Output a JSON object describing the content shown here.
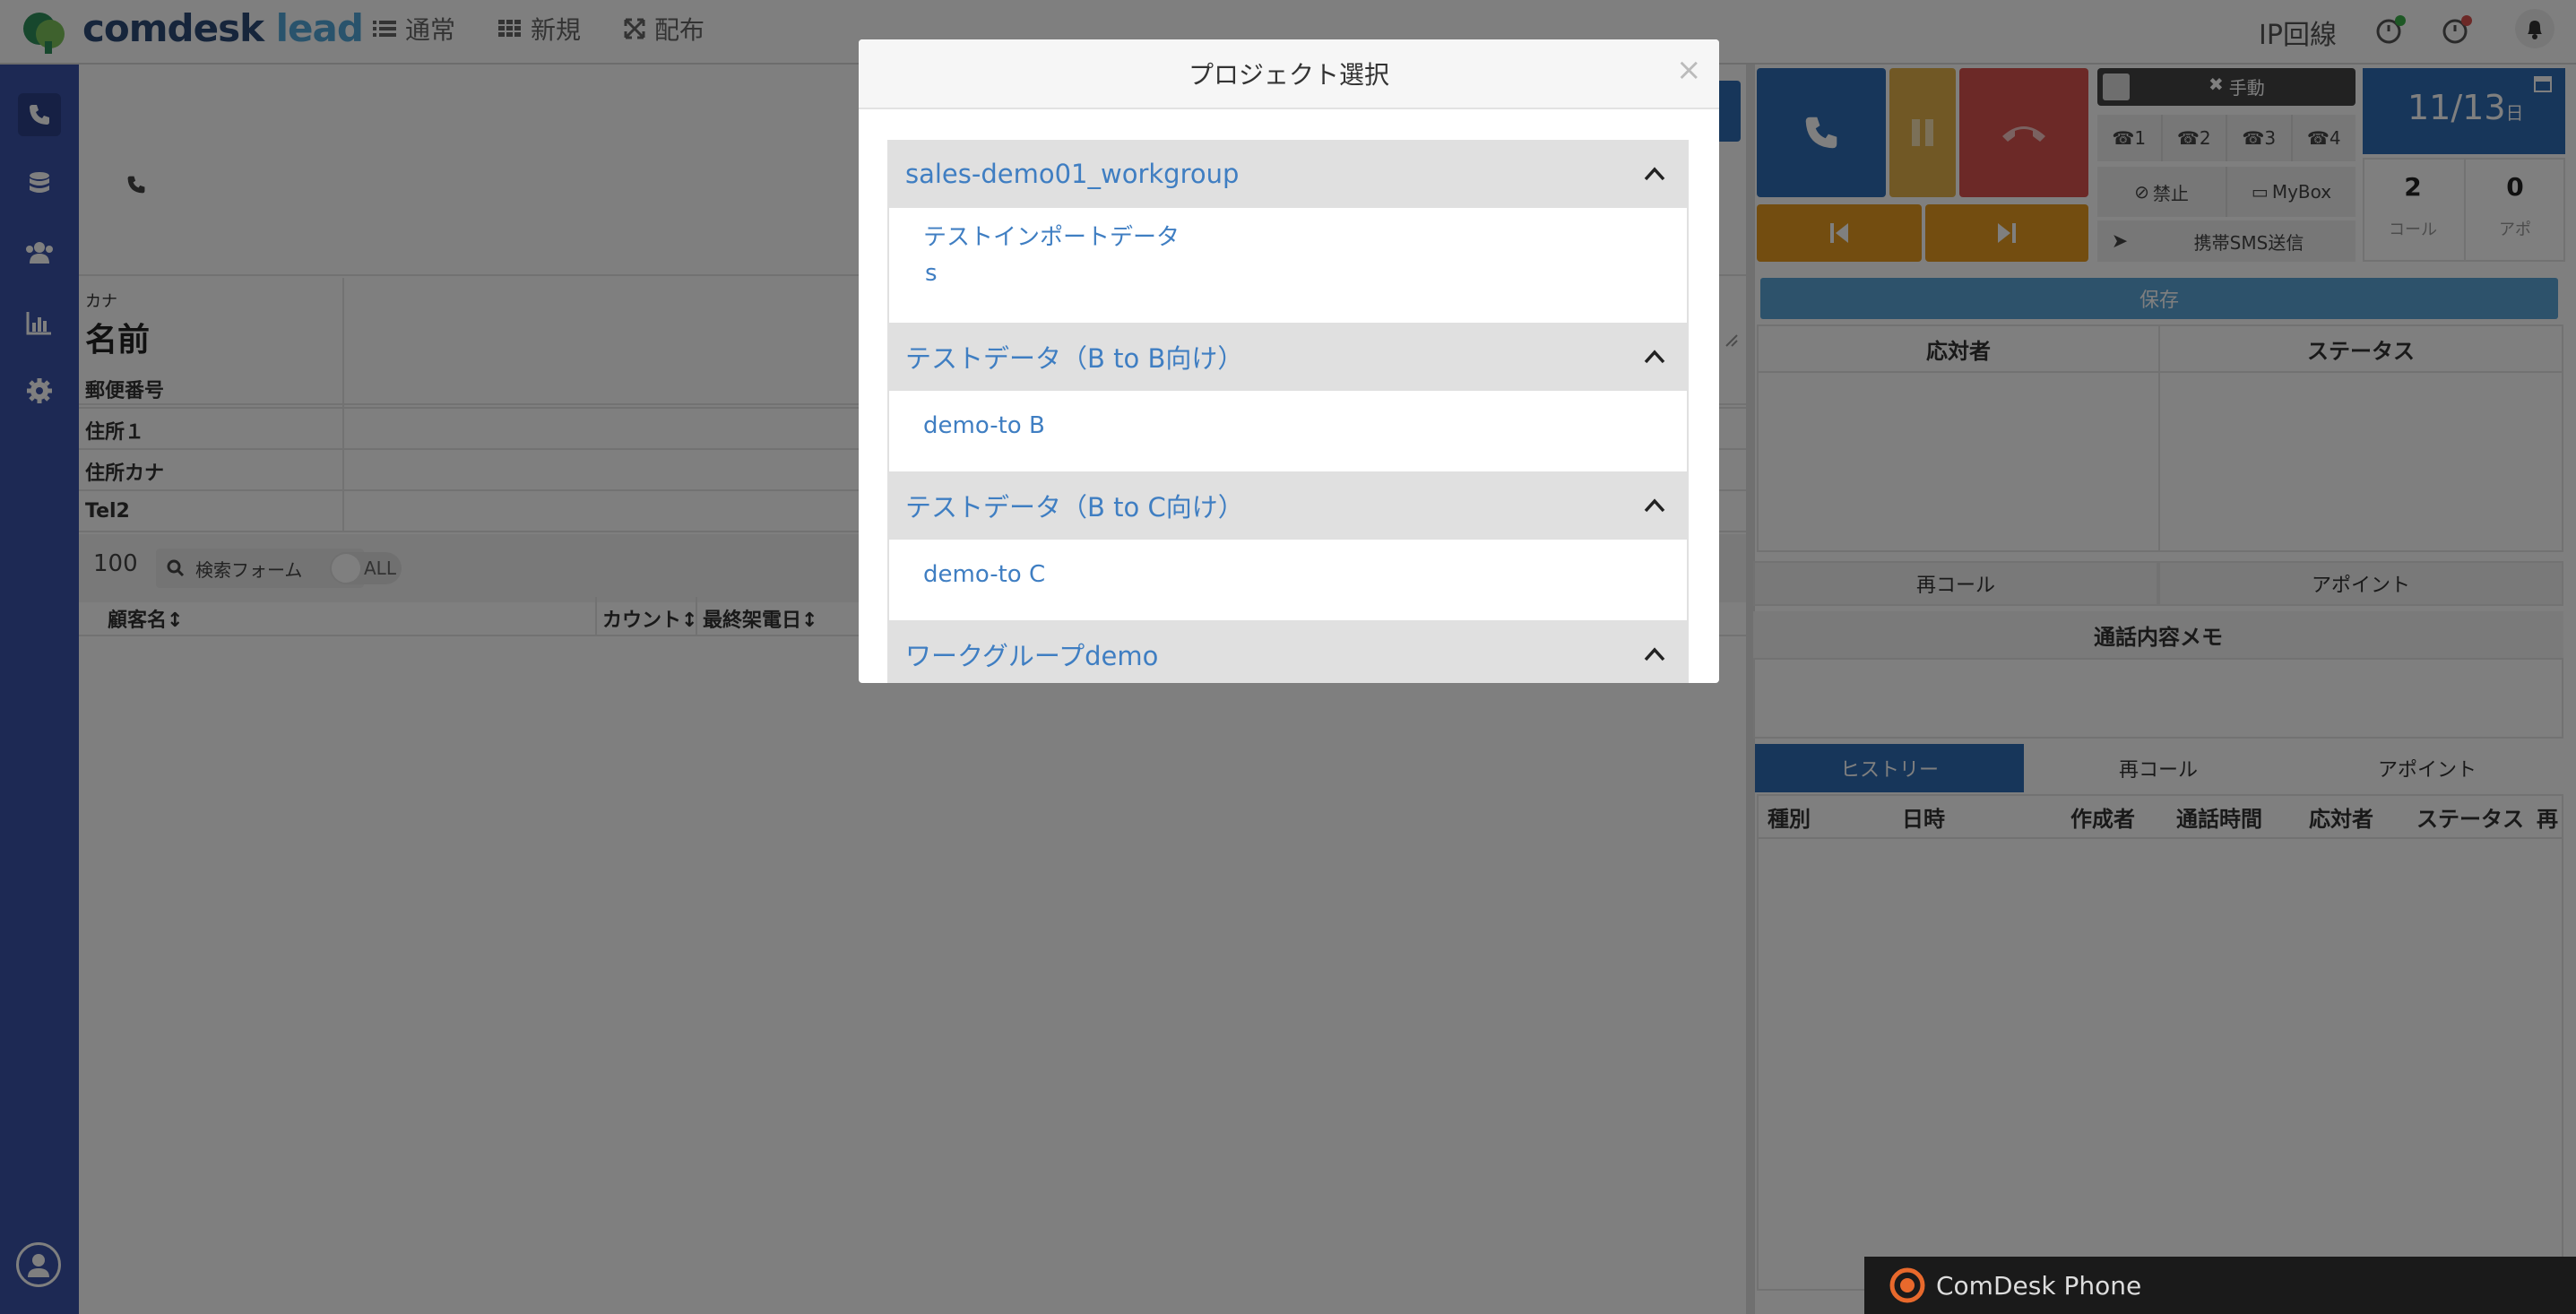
{
  "app": {
    "logo_main": "comdesk",
    "logo_accent": "lead",
    "nav": [
      {
        "label": "通常",
        "icon": "list-icon"
      },
      {
        "label": "新規",
        "icon": "grid-icon"
      },
      {
        "label": "配布",
        "icon": "expand-icon"
      }
    ],
    "line_label": "IP回線"
  },
  "form": {
    "kana_label": "カナ",
    "name_label": "名前",
    "postal_label": "郵便番号",
    "address1_label": "住所１",
    "address_kana_label": "住所カナ",
    "tel2_label": "Tel2"
  },
  "list": {
    "page_size": "100",
    "search_label": "検索フォーム",
    "all_label": "ALL",
    "columns": [
      "顧客名↕",
      "カウント↕",
      "最終架電日↕"
    ]
  },
  "phone": {
    "manual_label": "手動",
    "lines": [
      "1",
      "2",
      "3",
      "4"
    ],
    "ban_label": "禁止",
    "mybox_label": "MyBox",
    "sms_label": "携帯SMS送信",
    "date_label": "11/13",
    "date_suffix": "日",
    "call_count": "2",
    "call_count_label": "コール",
    "appoint_count": "0",
    "appoint_count_label": "アポ",
    "save_label": "保存",
    "responder_header": "応対者",
    "status_header": "ステータス",
    "recall_button": "再コール",
    "appoint_button": "アポイント",
    "memo_title": "通話内容メモ",
    "tabs": [
      "ヒストリー",
      "再コール",
      "アポイント"
    ],
    "history_columns": [
      "種別",
      "日時",
      "作成者",
      "通話時間",
      "応対者",
      "ステータス",
      "再"
    ],
    "softphone_label": "ComDesk Phone"
  },
  "modal": {
    "title": "プロジェクト選択",
    "close": "×",
    "groups": [
      {
        "name": "sales-demo01_workgroup",
        "items": [
          "テストインポートデータ",
          "s"
        ]
      },
      {
        "name": "テストデータ（B to B向け）",
        "items": [
          "demo-to B"
        ]
      },
      {
        "name": "テストデータ（B to C向け）",
        "items": [
          "demo-to C"
        ]
      },
      {
        "name": "ワークグループdemo",
        "items": []
      }
    ]
  },
  "colors": {
    "sidebar": "#3a53a8",
    "call_blue": "#2f6db5",
    "pause_yellow": "#e3b04b",
    "hangup_red": "#d9534f",
    "orange": "#e69b20",
    "link_blue": "#3f7ec2"
  }
}
